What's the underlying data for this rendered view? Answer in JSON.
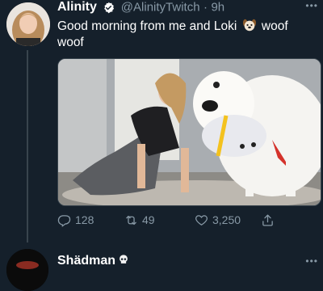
{
  "tweet": {
    "display_name": "Alinity",
    "handle": "@AlinityTwitch",
    "separator": "·",
    "time": "9h",
    "text_before_emoji": "Good morning from me and Loki",
    "text_after_emoji": "woof woof",
    "media_icon": "photo-dog-plush",
    "actions": {
      "reply_count": "128",
      "retweet_count": "49",
      "like_count": "3,250"
    }
  },
  "next_tweet": {
    "display_name": "Shädman"
  },
  "colors": {
    "background": "#15202b",
    "muted_text": "#8899a6",
    "verified": "#ffffff"
  }
}
